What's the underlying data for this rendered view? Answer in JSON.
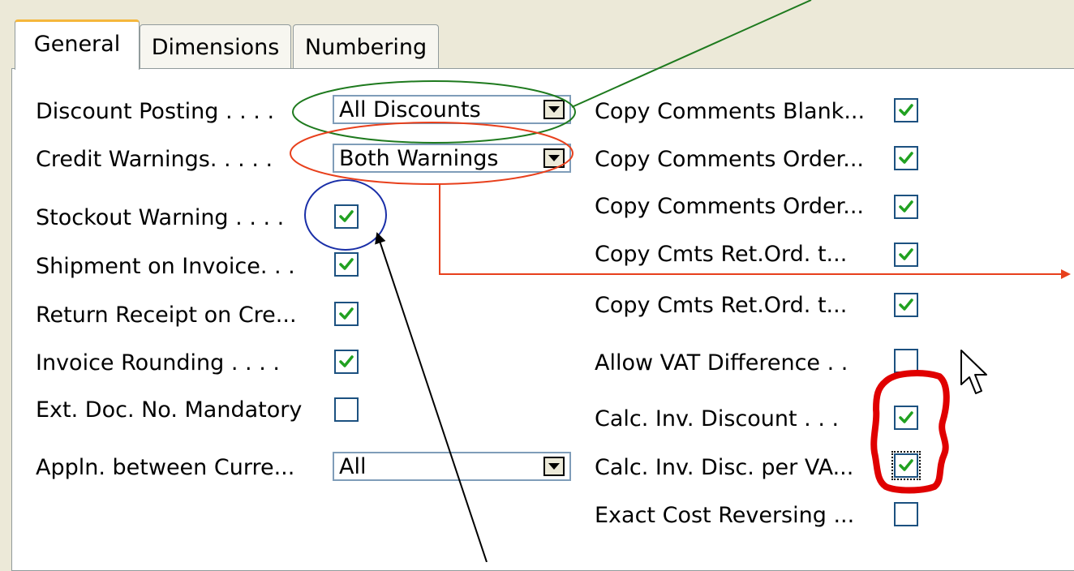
{
  "tabs": [
    {
      "label": "General",
      "active": true
    },
    {
      "label": "Dimensions",
      "active": false
    },
    {
      "label": "Numbering",
      "active": false
    }
  ],
  "fields": {
    "discount_posting": {
      "label": "Discount Posting . . . .",
      "value": "All Discounts"
    },
    "credit_warnings": {
      "label": "Credit Warnings. . . . .",
      "value": "Both Warnings"
    },
    "stockout_warning": {
      "label": "Stockout Warning . . . .",
      "checked": true
    },
    "shipment_on_invoice": {
      "label": "Shipment on Invoice. . .",
      "checked": true
    },
    "return_receipt": {
      "label": "Return Receipt on Cre...",
      "checked": true
    },
    "invoice_rounding": {
      "label": "Invoice Rounding . . . .",
      "checked": true
    },
    "ext_doc_no": {
      "label": "Ext. Doc. No. Mandatory",
      "checked": false
    },
    "appln_between": {
      "label": "Appln. between Curre...",
      "value": "All"
    },
    "copy_comments_blank": {
      "label": "Copy Comments Blank...",
      "checked": true
    },
    "copy_comments_order_1": {
      "label": "Copy Comments Order...",
      "checked": true
    },
    "copy_comments_order_2": {
      "label": "Copy Comments Order...",
      "checked": true
    },
    "copy_cmts_ret_1": {
      "label": "Copy Cmts Ret.Ord. t...",
      "checked": true
    },
    "copy_cmts_ret_2": {
      "label": "Copy Cmts Ret.Ord. t...",
      "checked": true
    },
    "allow_vat_difference": {
      "label": "Allow VAT Difference . .",
      "checked": false
    },
    "calc_inv_discount": {
      "label": "Calc. Inv. Discount . . .",
      "checked": true
    },
    "calc_inv_disc_per_vat": {
      "label": "Calc. Inv. Disc. per VA...",
      "checked": true
    },
    "exact_cost_reversing": {
      "label": "Exact Cost Reversing ...",
      "checked": false
    }
  },
  "colors": {
    "background": "#ece9d8",
    "panel": "#ffffff",
    "check": "#21a121",
    "checkbox_border": "#1c5180",
    "green_annotation": "#1e7a1e",
    "orange_annotation": "#e8401c",
    "blue_annotation": "#1a2fa8",
    "red_annotation": "#e00000"
  }
}
